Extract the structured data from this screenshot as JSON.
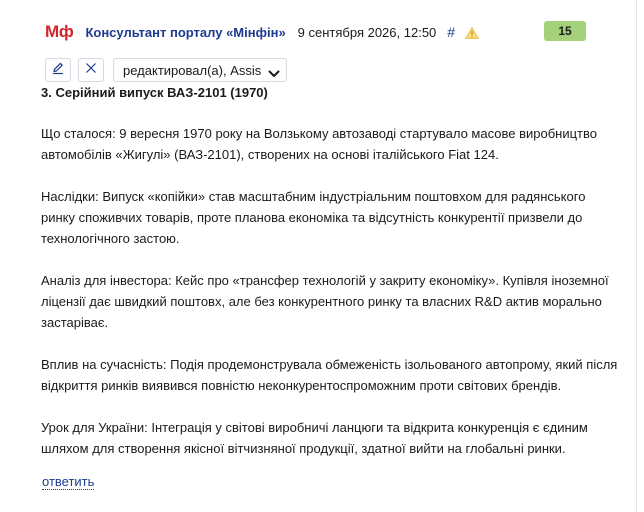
{
  "header": {
    "logo": "Мф",
    "author": "Консультант порталу «Мінфін»",
    "date": "9 сентября 2026, 12:50",
    "anchor": "#",
    "warning_icon": "warning-icon",
    "rating": "15"
  },
  "toolbar": {
    "edit_icon": "pencil-icon",
    "close_icon": "close-icon",
    "edited_label": "редактировал(а), Assis"
  },
  "content": {
    "title": "3. Серійний випуск ВАЗ-2101 (1970)",
    "paragraphs": [
      "Що сталося: 9 вересня 1970 року на Волзькому автозаводі стартувало масове виробництво автомобілів «Жигулі» (ВАЗ-2101), створених на основі італійського Fiat 124.",
      "Наслідки: Випуск «копійки» став масштабним індустріальним поштовхом для радянського ринку споживчих товарів, проте планова економіка та відсутність конкурентії призвели до технологічного застою.",
      "Аналіз для інвестора: Кейс про «трансфер технологій у закриту економіку». Купівля іноземної ліцензії дає швидкий поштовх, але без конкурентного ринку та власних R&D актив морально застаріває.",
      "Вплив на сучасність: Подія продемонструвала обмеженість ізольованого автопрому, який після відкриття ринків виявився повністю неконкурентоспроможним проти світових брендів.",
      "Урок для України: Інтеграція у світові виробничі ланцюги та відкрита конкуренція є єдиним шляхом для створення якісної вітчизняної продукції, здатної вийти на глобальні ринки."
    ]
  },
  "actions": {
    "reply_label": "ответить"
  },
  "colors": {
    "brand_red": "#d3262c",
    "link_blue": "#1d3a8f",
    "badge_green": "#a5d17b",
    "warning_yellow": "#f2c230"
  }
}
